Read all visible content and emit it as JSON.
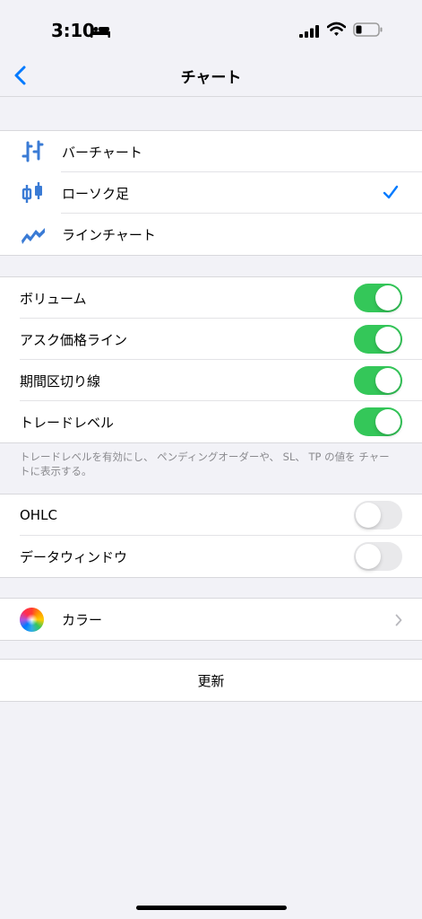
{
  "status_bar": {
    "time": "3:10"
  },
  "nav": {
    "title": "チャート"
  },
  "chart_types": [
    {
      "label": "バーチャート",
      "icon": "bar-chart-icon",
      "selected": false
    },
    {
      "label": "ローソク足",
      "icon": "candlestick-icon",
      "selected": true
    },
    {
      "label": "ラインチャート",
      "icon": "line-chart-icon",
      "selected": false
    }
  ],
  "display_toggles": [
    {
      "label": "ボリューム",
      "on": true
    },
    {
      "label": "アスク価格ライン",
      "on": true
    },
    {
      "label": "期間区切り線",
      "on": true
    },
    {
      "label": "トレードレベル",
      "on": true
    }
  ],
  "trade_level_note": "トレードレベルを有効にし、 ペンディングオーダーや、 SL、 TP の値を チャートに表示する。",
  "window_toggles": [
    {
      "label": "OHLC",
      "on": false
    },
    {
      "label": "データウィンドウ",
      "on": false
    }
  ],
  "color_item": {
    "label": "カラー",
    "icon": "color-wheel-icon"
  },
  "refresh_button": {
    "label": "更新"
  },
  "colors": {
    "accent": "#007aff",
    "toggle_on": "#34c759",
    "toggle_off": "#e9e9eb",
    "background": "#f2f2f7"
  }
}
